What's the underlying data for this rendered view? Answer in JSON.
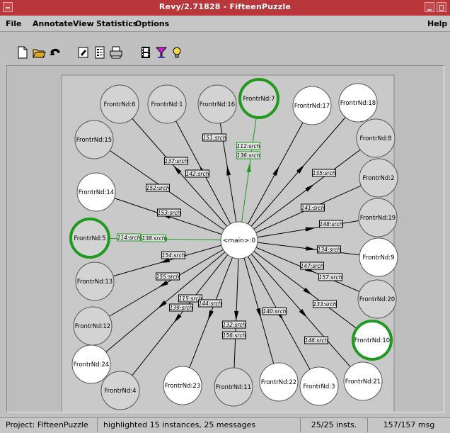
{
  "window": {
    "title": "Revy/2.71828 - FifteenPuzzle"
  },
  "menu": {
    "file": "File",
    "annotate": "Annotate",
    "view": "View",
    "statistics": "Statistics",
    "options": "Options",
    "help": "Help"
  },
  "graph": {
    "center_label": "<main>:0",
    "nodes": [
      {
        "label": "FrontrNd:6",
        "fill": "gray"
      },
      {
        "label": "FrontrNd:1",
        "fill": "gray"
      },
      {
        "label": "FrontrNd:16",
        "fill": "gray"
      },
      {
        "label": "FrontrNd:7",
        "fill": "gray",
        "highlighted": true
      },
      {
        "label": "FrontrNd:17",
        "fill": "white"
      },
      {
        "label": "FrontrNd:18",
        "fill": "white"
      },
      {
        "label": "FrontrNd:15",
        "fill": "gray"
      },
      {
        "label": "FrontrNd:8",
        "fill": "gray"
      },
      {
        "label": "FrontrNd:2",
        "fill": "gray"
      },
      {
        "label": "FrontrNd:14",
        "fill": "white"
      },
      {
        "label": "FrontrNd:19",
        "fill": "gray"
      },
      {
        "label": "FrontrNd:5",
        "fill": "gray",
        "highlighted": true
      },
      {
        "label": "FrontrNd:9",
        "fill": "white"
      },
      {
        "label": "FrontrNd:13",
        "fill": "gray"
      },
      {
        "label": "FrontrNd:20",
        "fill": "gray"
      },
      {
        "label": "FrontrNd:12",
        "fill": "gray"
      },
      {
        "label": "FrontrNd:10",
        "fill": "white",
        "highlighted": true
      },
      {
        "label": "FrontrNd:24",
        "fill": "white"
      },
      {
        "label": "FrontrNd:4",
        "fill": "gray"
      },
      {
        "label": "FrontrNd:23",
        "fill": "white"
      },
      {
        "label": "FrontrNd:11",
        "fill": "gray"
      },
      {
        "label": "FrontrNd:22",
        "fill": "white"
      },
      {
        "label": "FrontrNd:3",
        "fill": "white"
      },
      {
        "label": "FrontrNd:21",
        "fill": "white"
      }
    ],
    "messages": [
      {
        "label": "151:srch"
      },
      {
        "label": "112:srch",
        "highlighted": true
      },
      {
        "label": "136:srch",
        "highlighted": true
      },
      {
        "label": "137:srch"
      },
      {
        "label": "142:srch"
      },
      {
        "label": "135:srch"
      },
      {
        "label": "152:srch"
      },
      {
        "label": "141:srch"
      },
      {
        "label": "153:srch"
      },
      {
        "label": "148:srch"
      },
      {
        "label": "114:srch",
        "highlighted": true
      },
      {
        "label": "138:srch",
        "highlighted": true
      },
      {
        "label": "134:srch"
      },
      {
        "label": "154:srch"
      },
      {
        "label": "147:srch"
      },
      {
        "label": "157:srch"
      },
      {
        "label": "155:srch"
      },
      {
        "label": "133:srch"
      },
      {
        "label": "115:srch"
      },
      {
        "label": "139:srch"
      },
      {
        "label": "144:srch"
      },
      {
        "label": "132:srch"
      },
      {
        "label": "156:srch"
      },
      {
        "label": "140:srch"
      },
      {
        "label": "146:srch"
      }
    ]
  },
  "status": {
    "project": "Project: FifteenPuzzle",
    "message": "highlighted 15 instances, 25 messages",
    "insts": "25/25 insts.",
    "msgs": "157/157 msg"
  },
  "colors": {
    "titlebar": "#b9363a",
    "highlight": "#1f9a1f",
    "node_gray": "#d3d3d3",
    "node_white": "#ffffff"
  },
  "toolbar_icons": [
    "new-file-icon",
    "open-folder-icon",
    "undo-icon",
    "edit-icon",
    "list-icon",
    "print-icon",
    "film-icon",
    "filter-icon",
    "bulb-icon"
  ]
}
